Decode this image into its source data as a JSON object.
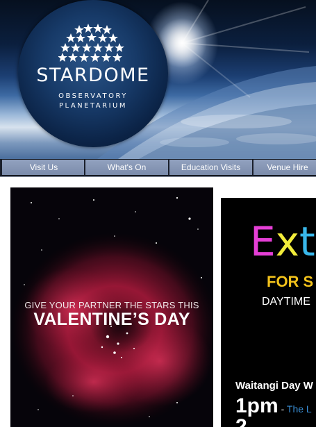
{
  "logo": {
    "title": "STARDOME",
    "subtitle_line1": "OBSERVATORY",
    "subtitle_line2": "PLANETARIUM"
  },
  "nav": {
    "items": [
      {
        "label": "Visit Us"
      },
      {
        "label": "What's On"
      },
      {
        "label": "Education Visits"
      },
      {
        "label": "Venue Hire"
      }
    ]
  },
  "promo_left": {
    "line1": "GIVE YOUR PARTNER THE STARS THIS",
    "line2": "VALENTINE’S DAY"
  },
  "promo_right": {
    "word_e": "E",
    "word_x": "x",
    "word_t": "t",
    "for_text": "FOR S",
    "daytime_text": "DAYTIME",
    "event_title": "Waitangi Day W",
    "time": "1pm",
    "dash": " - ",
    "link_text": "The L",
    "next_time": "2"
  },
  "colors": {
    "nav_button": "#7f90ae",
    "nav_bar": "#141820",
    "promo_magenta": "#e53fd6",
    "promo_yellow": "#f2ec3a",
    "promo_cyan": "#39b7ea",
    "promo_gold": "#f2c21b",
    "link_blue": "#3a8fd6"
  }
}
